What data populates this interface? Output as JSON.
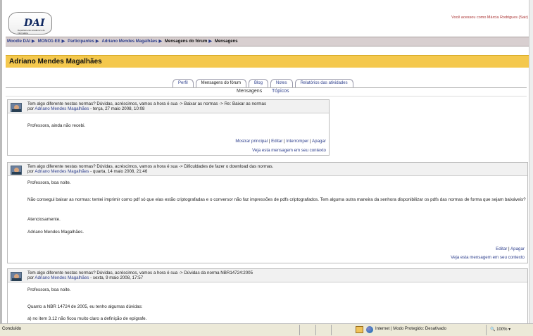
{
  "header": {
    "logo_text": "DAI",
    "logo_subtitle": "Departamento Acadêmico de Informática",
    "login_text": "Você acessou como Márcia Rodrigues (Sair)"
  },
  "breadcrumb": [
    "Moodle DAI",
    "MONO1-EE",
    "Participantes",
    "Adriano Mendes Magalhães",
    "Mensagens do fórum",
    "Mensagens"
  ],
  "page_title": "Adriano Mendes Magalhães",
  "tabs": [
    "Perfil",
    "Mensagens do fórum",
    "Blog",
    "Notes",
    "Relatórios das atividades"
  ],
  "subtabs": [
    "Mensagens",
    "Tópicos"
  ],
  "posts": [
    {
      "subject": "Tem algo diferente nestas normas? Dúvidas, acréscimos, vamos a hora é sua -> Baixar as normas -> Re: Baixar as normas",
      "author_prefix": "por ",
      "author": "Adriano Mendes Magalhães",
      "date": " - terça, 27 maio 2008, 10:08",
      "body": [
        "Professora, ainda não recebi."
      ],
      "commands": [
        "Mostrar principal",
        "Editar",
        "Interromper",
        "Apagar"
      ],
      "context": "Veja esta mensagem em seu contexto"
    },
    {
      "subject": "Tem algo diferente nestas normas? Dúvidas, acréscimos, vamos a hora é sua -> Dificuldades de fazer o download das normas.",
      "author_prefix": "por ",
      "author": "Adriano Mendes Magalhães",
      "date": " - quarta, 14 maio 2008, 21:46",
      "body": [
        "Professora, boa noite.",
        "Não consegui baixar as normas: tentei imprimir como pdf só que elas estão criptografadas e o conversor não faz impressões de pdfs criptografados. Tem alguma outra maneira da senhora disponibilizar os pdfs das normas de forma que sejam baixáveis?",
        "Atenciosamente.",
        "Adriano Mendes Magalhães."
      ],
      "commands": [
        "Editar",
        "Apagar"
      ],
      "context": "Veja esta mensagem em seu contexto"
    },
    {
      "subject": "Tem algo diferente nestas normas? Dúvidas, acréscimos, vamos a hora é sua -> Dúvidas da norma NBR14724:2005",
      "author_prefix": "por ",
      "author": "Adriano Mendes Magalhães",
      "date": " - sexta, 9 maio 2008, 17:57",
      "body": [
        "Professora, boa noite.",
        "Quanto a NBR 14724 de 2005, eu tenho algumas dúvidas:",
        "a) no item 3.12 não ficou muito claro a definição de epígrafe."
      ]
    }
  ],
  "statusbar": {
    "left_text": "Concluído",
    "zone_text": "Internet | Modo Protegido: Desativado",
    "zoom_text": "100%"
  }
}
